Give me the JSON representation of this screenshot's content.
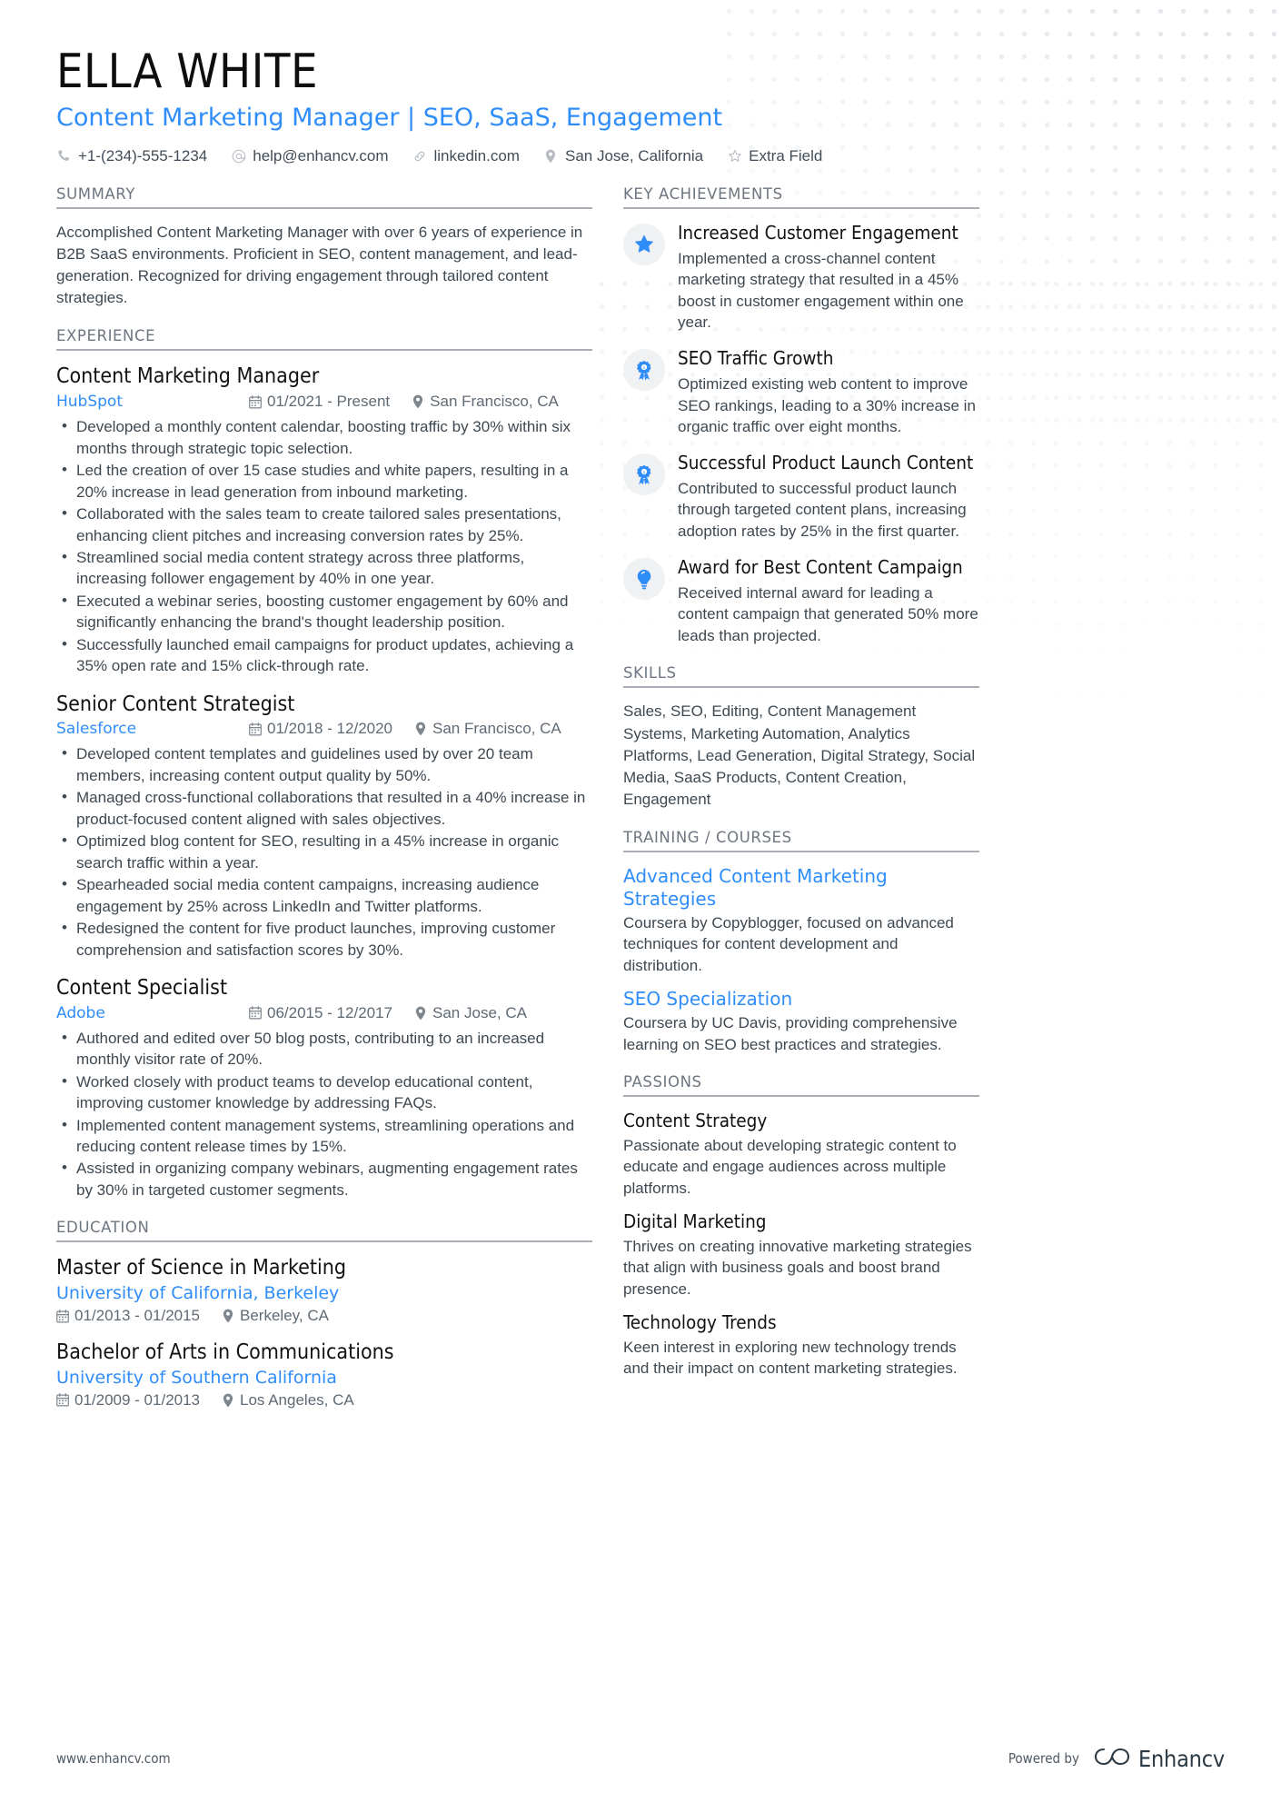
{
  "header": {
    "name": "ELLA WHITE",
    "headline": "Content Marketing Manager | SEO, SaaS, Engagement",
    "contacts": [
      {
        "icon": "phone-icon",
        "text": "+1-(234)-555-1234"
      },
      {
        "icon": "email-icon",
        "text": "help@enhancv.com"
      },
      {
        "icon": "link-icon",
        "text": "linkedin.com"
      },
      {
        "icon": "location-pin-icon",
        "text": "San Jose, California"
      },
      {
        "icon": "star-outline-icon",
        "text": "Extra Field"
      }
    ]
  },
  "left": {
    "summary": {
      "heading": "SUMMARY",
      "text": "Accomplished Content Marketing Manager with over 6 years of experience in B2B SaaS environments. Proficient in SEO, content management, and lead-generation. Recognized for driving engagement through tailored content strategies."
    },
    "experience": {
      "heading": "EXPERIENCE",
      "jobs": [
        {
          "title": "Content Marketing Manager",
          "company": "HubSpot",
          "dates": "01/2021 - Present",
          "location": "San Francisco, CA",
          "bullets": [
            "Developed a monthly content calendar, boosting traffic by 30% within six months through strategic topic selection.",
            "Led the creation of over 15 case studies and white papers, resulting in a 20% increase in lead generation from inbound marketing.",
            "Collaborated with the sales team to create tailored sales presentations, enhancing client pitches and increasing conversion rates by 25%.",
            "Streamlined social media content strategy across three platforms, increasing follower engagement by 40% in one year.",
            "Executed a webinar series, boosting customer engagement by 60% and significantly enhancing the brand's thought leadership position.",
            "Successfully launched email campaigns for product updates, achieving a 35% open rate and 15% click-through rate."
          ]
        },
        {
          "title": "Senior Content Strategist",
          "company": "Salesforce",
          "dates": "01/2018 - 12/2020",
          "location": "San Francisco, CA",
          "bullets": [
            "Developed content templates and guidelines used by over 20 team members, increasing content output quality by 50%.",
            "Managed cross-functional collaborations that resulted in a 40% increase in product-focused content aligned with sales objectives.",
            "Optimized blog content for SEO, resulting in a 45% increase in organic search traffic within a year.",
            "Spearheaded social media content campaigns, increasing audience engagement by 25% across LinkedIn and Twitter platforms.",
            "Redesigned the content for five product launches, improving customer comprehension and satisfaction scores by 30%."
          ]
        },
        {
          "title": "Content Specialist",
          "company": "Adobe",
          "dates": "06/2015 - 12/2017",
          "location": "San Jose, CA",
          "bullets": [
            "Authored and edited over 50 blog posts, contributing to an increased monthly visitor rate of 20%.",
            "Worked closely with product teams to develop educational content, improving customer knowledge by addressing FAQs.",
            "Implemented content management systems, streamlining operations and reducing content release times by 15%.",
            "Assisted in organizing company webinars, augmenting engagement rates by 30% in targeted customer segments."
          ]
        }
      ]
    },
    "education": {
      "heading": "EDUCATION",
      "entries": [
        {
          "degree": "Master of Science in Marketing",
          "school": "University of California, Berkeley",
          "dates": "01/2013 - 01/2015",
          "location": "Berkeley, CA"
        },
        {
          "degree": "Bachelor of Arts in Communications",
          "school": "University of Southern California",
          "dates": "01/2009 - 01/2013",
          "location": "Los Angeles, CA"
        }
      ]
    }
  },
  "right": {
    "achievements": {
      "heading": "KEY ACHIEVEMENTS",
      "items": [
        {
          "icon": "star-icon",
          "title": "Increased Customer Engagement",
          "desc": "Implemented a cross-channel content marketing strategy that resulted in a 45% boost in customer engagement within one year."
        },
        {
          "icon": "award-ribbon-icon",
          "title": "SEO Traffic Growth",
          "desc": "Optimized existing web content to improve SEO rankings, leading to a 30% increase in organic traffic over eight months."
        },
        {
          "icon": "award-ribbon-icon",
          "title": "Successful Product Launch Content",
          "desc": "Contributed to successful product launch through targeted content plans, increasing adoption rates by 25% in the first quarter."
        },
        {
          "icon": "lightbulb-icon",
          "title": "Award for Best Content Campaign",
          "desc": "Received internal award for leading a content campaign that generated 50% more leads than projected."
        }
      ]
    },
    "skills": {
      "heading": "SKILLS",
      "text": "Sales, SEO, Editing, Content Management Systems, Marketing Automation, Analytics Platforms, Lead Generation, Digital Strategy, Social Media, SaaS Products, Content Creation, Engagement"
    },
    "training": {
      "heading": "TRAINING / COURSES",
      "courses": [
        {
          "name": "Advanced Content Marketing Strategies",
          "desc": "Coursera by Copyblogger, focused on advanced techniques for content development and distribution."
        },
        {
          "name": "SEO Specialization",
          "desc": "Coursera by UC Davis, providing comprehensive learning on SEO best practices and strategies."
        }
      ]
    },
    "passions": {
      "heading": "PASSIONS",
      "items": [
        {
          "name": "Content Strategy",
          "desc": "Passionate about developing strategic content to educate and engage audiences across multiple platforms."
        },
        {
          "name": "Digital Marketing",
          "desc": "Thrives on creating innovative marketing strategies that align with business goals and boost brand presence."
        },
        {
          "name": "Technology Trends",
          "desc": "Keen interest in exploring new technology trends and their impact on content marketing strategies."
        }
      ]
    }
  },
  "footer": {
    "url": "www.enhancv.com",
    "powered_by": "Powered by",
    "brand": "Enhancv"
  },
  "colors": {
    "accent": "#2f8dfa",
    "text": "#3e4851",
    "heading": "#6d7680",
    "rule": "#a9aeb4"
  }
}
